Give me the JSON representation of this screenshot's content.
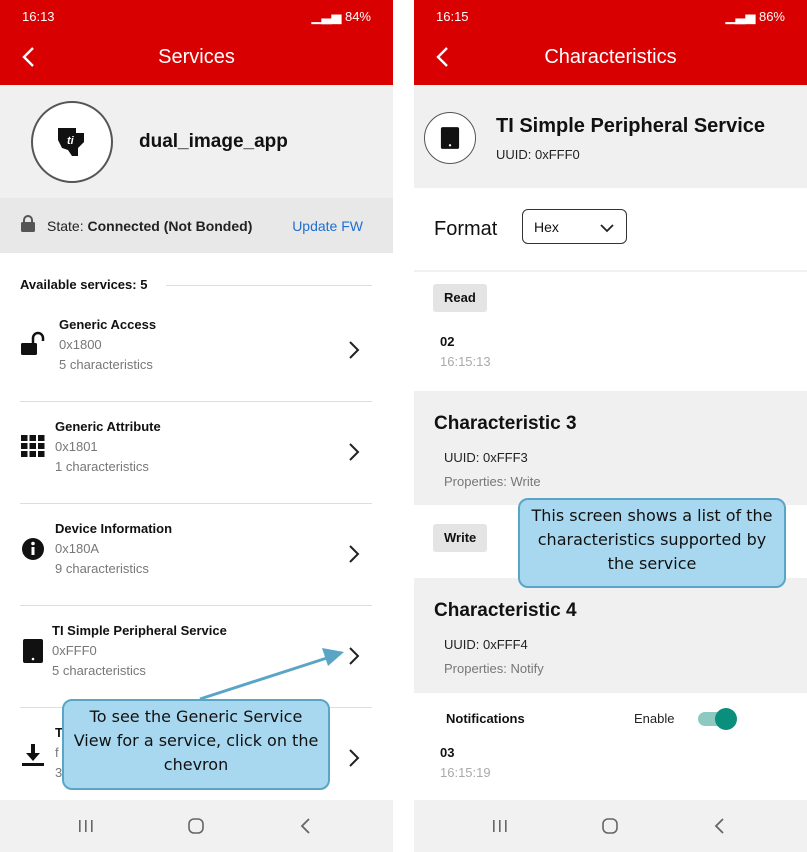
{
  "left_screen": {
    "status": {
      "time": "16:13",
      "battery": "84%"
    },
    "title": "Services",
    "device_name": "dual_image_app",
    "state_label": "State:",
    "state_value": "Connected (Not Bonded)",
    "update_fw": "Update FW",
    "available_services": "Available services: 5",
    "services": [
      {
        "name": "Generic Access",
        "uuid": "0x1800",
        "count": "5 characteristics",
        "icon": "lock-open-icon"
      },
      {
        "name": "Generic Attribute",
        "uuid": "0x1801",
        "count": "1 characteristics",
        "icon": "grid-icon"
      },
      {
        "name": "Device Information",
        "uuid": "0x180A",
        "count": "9 characteristics",
        "icon": "info-icon"
      },
      {
        "name": "TI Simple Peripheral Service",
        "uuid": "0xFFF0",
        "count": "5 characteristics",
        "icon": "tablet-icon"
      },
      {
        "name": "T",
        "uuid": "f",
        "count": "3",
        "icon": "download-icon"
      }
    ],
    "callout": "To see the Generic Service View for a service, click on the chevron"
  },
  "right_screen": {
    "status": {
      "time": "16:15",
      "battery": "86%"
    },
    "title": "Characteristics",
    "service_name": "TI Simple Peripheral Service",
    "service_uuid": "UUID: 0xFFF0",
    "format_label": "Format",
    "format_value": "Hex",
    "read_button": "Read",
    "read_value": "02",
    "read_time": "16:15:13",
    "char3": {
      "title": "Characteristic 3",
      "uuid": "UUID: 0xFFF3",
      "props": "Properties: Write"
    },
    "write_button": "Write",
    "callout": "This screen shows a list of the characteristics supported by the service",
    "char4": {
      "title": "Characteristic 4",
      "uuid": "UUID: 0xFFF4",
      "props": "Properties: Notify"
    },
    "notifications_label": "Notifications",
    "enable_label": "Enable",
    "notify_enabled": true,
    "notify_value": "03",
    "notify_time": "16:15:19"
  },
  "colors": {
    "appbar": "#d80000",
    "link": "#1f6fd1",
    "callout_fill": "#a8d8ef",
    "callout_border": "#5aa5c6",
    "toggle": "#0a8f7c"
  }
}
